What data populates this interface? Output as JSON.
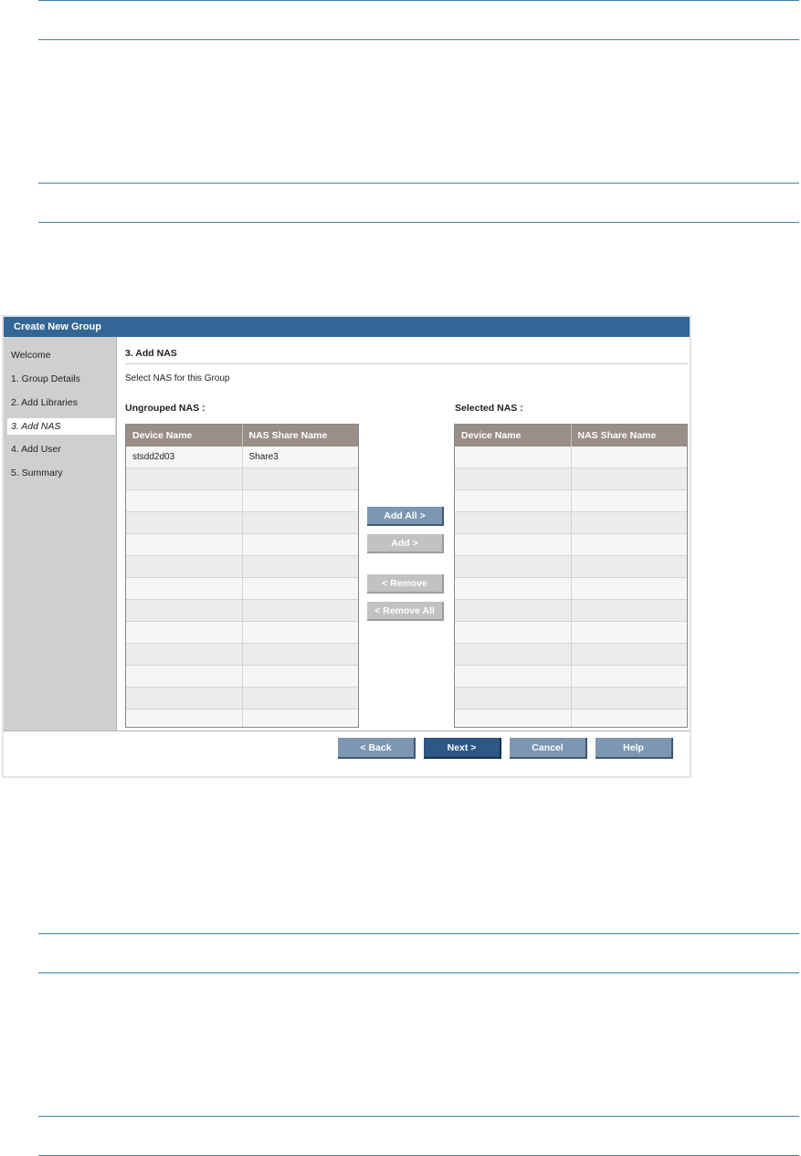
{
  "dialog": {
    "title": "Create New Group"
  },
  "sidebar": {
    "items": [
      {
        "label": "Welcome",
        "active": false
      },
      {
        "label": "1. Group Details",
        "active": false
      },
      {
        "label": "2. Add Libraries",
        "active": false
      },
      {
        "label": "3. Add NAS",
        "active": true
      },
      {
        "label": "4. Add User",
        "active": false
      },
      {
        "label": "5. Summary",
        "active": false
      }
    ]
  },
  "main": {
    "step_title": "3. Add NAS",
    "instruction": "Select NAS for this Group",
    "ungrouped_label": "Ungrouped NAS :",
    "selected_label": "Selected NAS :"
  },
  "ungrouped_table": {
    "columns": [
      "Device Name",
      "NAS Share Name"
    ],
    "rows": [
      [
        "stsdd2d03",
        "Share3"
      ]
    ]
  },
  "selected_table": {
    "columns": [
      "Device Name",
      "NAS Share Name"
    ],
    "rows": []
  },
  "transfer_buttons": {
    "add_all": "Add All >",
    "add": "Add >",
    "remove": "< Remove",
    "remove_all": "< Remove All"
  },
  "footer": {
    "back": "< Back",
    "next": "Next >",
    "cancel": "Cancel",
    "help": "Help"
  }
}
